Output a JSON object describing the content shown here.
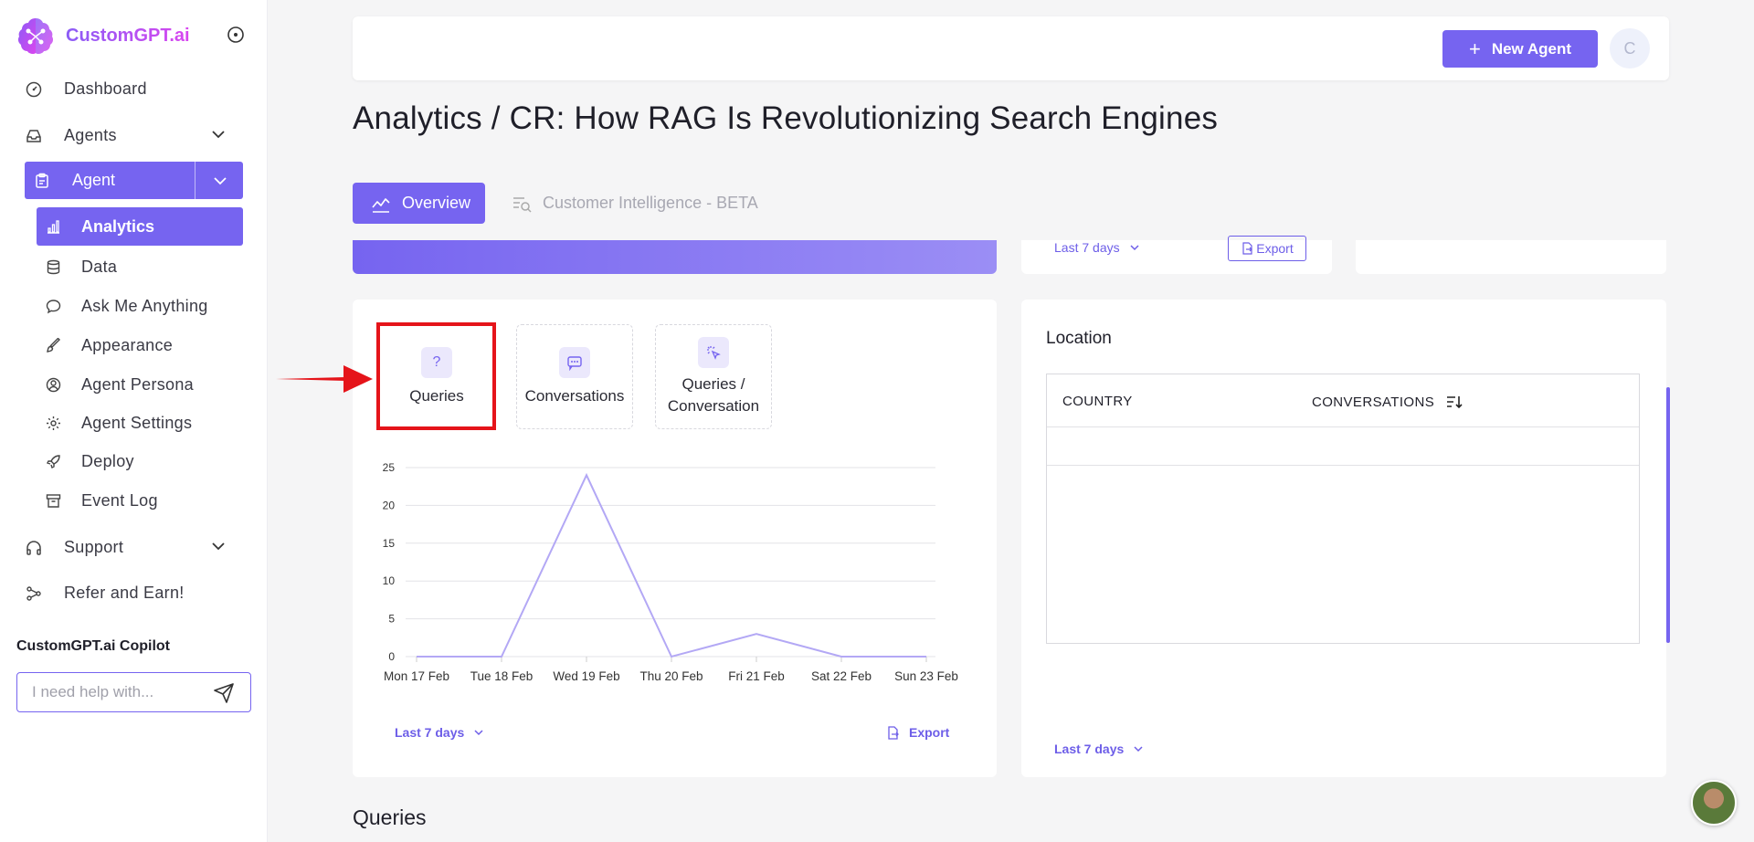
{
  "sidebar": {
    "brand": "CustomGPT.ai",
    "nav": {
      "dashboard": "Dashboard",
      "agents": "Agents",
      "agent": "Agent",
      "support": "Support",
      "refer": "Refer and Earn!"
    },
    "agent_sub": {
      "analytics": "Analytics",
      "data": "Data",
      "ask_me_anything": "Ask Me Anything",
      "appearance": "Appearance",
      "agent_persona": "Agent Persona",
      "agent_settings": "Agent Settings",
      "deploy": "Deploy",
      "event_log": "Event Log"
    },
    "copilot": {
      "title": "CustomGPT.ai Copilot",
      "placeholder": "I need help with..."
    }
  },
  "topbar": {
    "new_agent_label": "New Agent",
    "avatar_initial": "C"
  },
  "page_title": "Analytics / CR: How RAG Is Revolutionizing Search Engines",
  "tabs": {
    "overview": "Overview",
    "customer_intelligence": "Customer Intelligence - BETA"
  },
  "top_cards": {
    "range": "Last 7 days",
    "export": "Export"
  },
  "metrics": {
    "queries": "Queries",
    "conversations": "Conversations",
    "queries_per_conversation_line1": "Queries /",
    "queries_per_conversation_line2": "Conversation"
  },
  "chart_card": {
    "range": "Last 7 days",
    "export": "Export"
  },
  "chart_data": {
    "type": "line",
    "categories": [
      "Mon 17 Feb",
      "Tue 18 Feb",
      "Wed 19 Feb",
      "Thu 20 Feb",
      "Fri 21 Feb",
      "Sat 22 Feb",
      "Sun 23 Feb"
    ],
    "series": [
      {
        "values": [
          0,
          0,
          24,
          0,
          3,
          0,
          0
        ]
      }
    ],
    "yticks": [
      "0",
      "5",
      "10",
      "15",
      "20",
      "25"
    ],
    "ylim": [
      0,
      25
    ],
    "grid": true,
    "line_color": "#b3a8f5"
  },
  "location": {
    "title": "Location",
    "col_country": "COUNTRY",
    "col_conversations": "CONVERSATIONS",
    "range": "Last 7 days"
  },
  "queries_heading": "Queries",
  "colors": {
    "accent": "#7664f0",
    "highlight": "#e5141a"
  }
}
